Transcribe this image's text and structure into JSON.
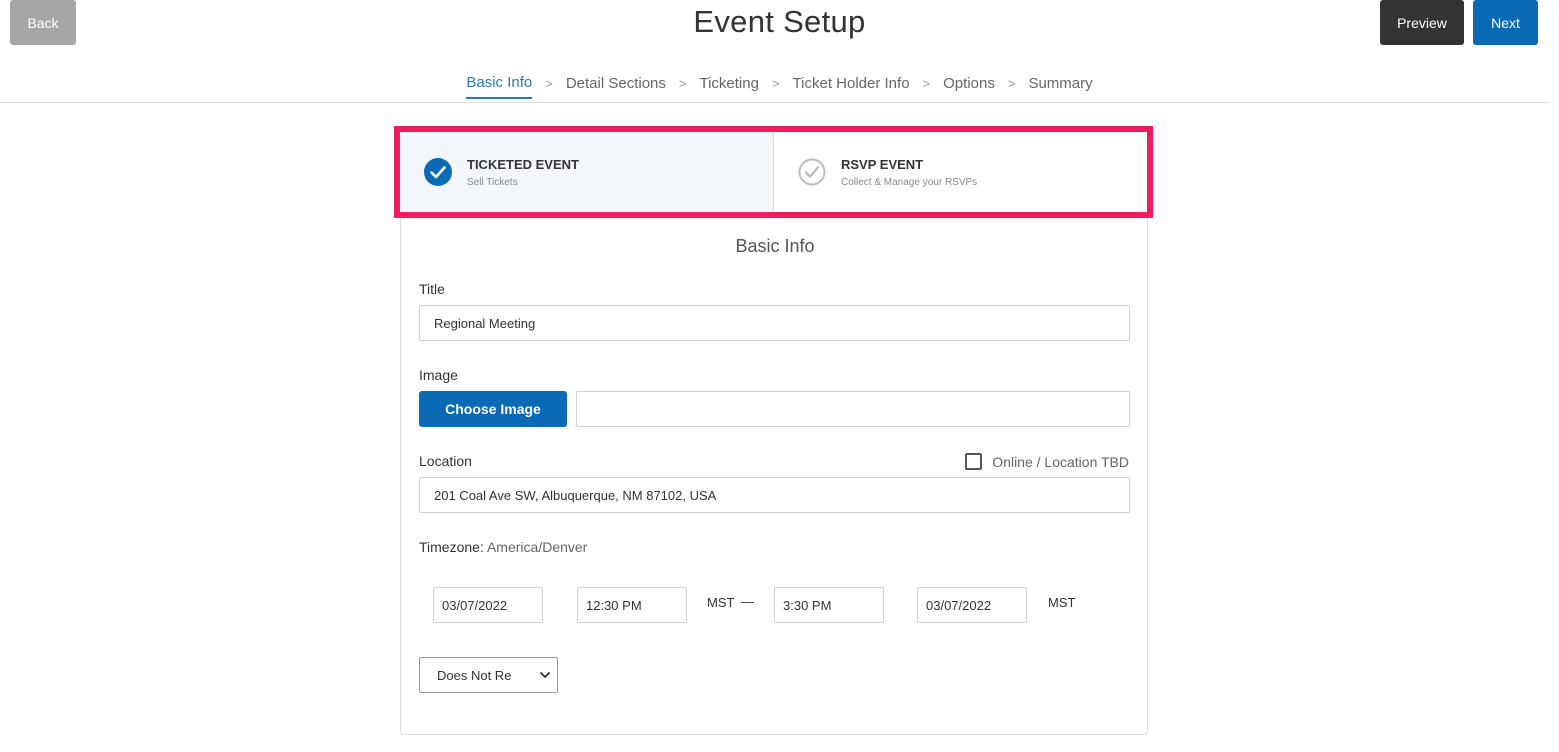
{
  "header": {
    "back_label": "Back",
    "title": "Event Setup",
    "preview_label": "Preview",
    "next_label": "Next"
  },
  "steps": [
    {
      "label": "Basic Info",
      "active": true
    },
    {
      "label": "Detail Sections",
      "active": false
    },
    {
      "label": "Ticketing",
      "active": false
    },
    {
      "label": "Ticket Holder Info",
      "active": false
    },
    {
      "label": "Options",
      "active": false
    },
    {
      "label": "Summary",
      "active": false
    }
  ],
  "event_type": {
    "ticketed": {
      "title": "TICKETED EVENT",
      "subtitle": "Sell Tickets",
      "icon": "check-circle-icon",
      "selected": true
    },
    "rsvp": {
      "title": "RSVP EVENT",
      "subtitle": "Collect & Manage your RSVPs",
      "icon": "check-circle-outline-icon",
      "selected": false
    }
  },
  "basic_info": {
    "heading": "Basic Info",
    "title_label": "Title",
    "title_value": "Regional Meeting",
    "image_label": "Image",
    "choose_image_label": "Choose Image",
    "image_value": "",
    "location_label": "Location",
    "online_label": "Online / Location TBD",
    "location_value": "201 Coal Ave SW, Albuquerque, NM 87102, USA",
    "timezone_label": "Timezone:",
    "timezone_value": "America/Denver",
    "start_date": "03/07/2022",
    "start_time": "12:30 PM",
    "start_tz": "MST",
    "dash": "—",
    "end_time": "3:30 PM",
    "end_date": "03/07/2022",
    "end_tz": "MST",
    "recurrence_value": "Does Not Re"
  },
  "colors": {
    "accent": "#0a6ab6",
    "highlight": "#ee1d5e",
    "dark_button": "#333333",
    "back_button": "#a6a6a6"
  }
}
